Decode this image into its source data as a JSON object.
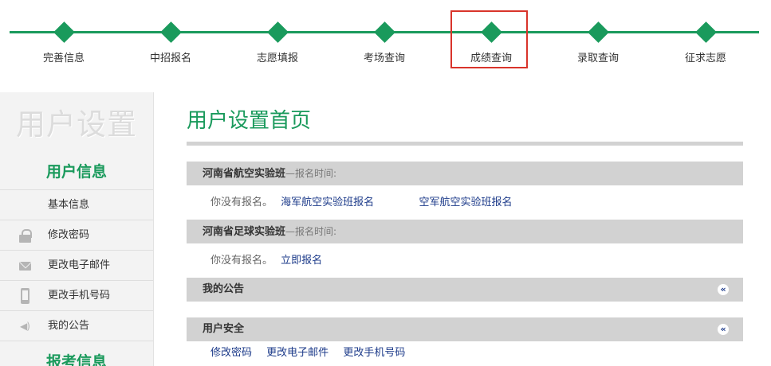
{
  "steps": [
    {
      "label": "完善信息"
    },
    {
      "label": "中招报名"
    },
    {
      "label": "志愿填报"
    },
    {
      "label": "考场查询"
    },
    {
      "label": "成绩查询"
    },
    {
      "label": "录取查询"
    },
    {
      "label": "征求志愿"
    }
  ],
  "sidebar": {
    "title": "用户设置",
    "section_user": "用户信息",
    "items": [
      {
        "label": "基本信息",
        "icon": "none"
      },
      {
        "label": "修改密码",
        "icon": "lock-icon"
      },
      {
        "label": "更改电子邮件",
        "icon": "mail-icon"
      },
      {
        "label": "更改手机号码",
        "icon": "phone-icon"
      },
      {
        "label": "我的公告",
        "icon": "speaker-icon"
      }
    ],
    "section_exam": "报考信息"
  },
  "main": {
    "title": "用户设置首页",
    "aviation": {
      "title": "河南省航空实验班",
      "sub": "—报名时间:",
      "status": "你没有报名。",
      "link1": "海军航空实验班报名",
      "link2": "空军航空实验班报名"
    },
    "football": {
      "title": "河南省足球实验班",
      "sub": "—报名时间:",
      "status": "你没有报名。",
      "link": "立即报名"
    },
    "notice": {
      "title": "我的公告",
      "toggle": "«"
    },
    "security": {
      "title": "用户安全",
      "toggle": "«",
      "links": [
        "修改密码",
        "更改电子邮件",
        "更改手机号码"
      ]
    }
  },
  "colors": {
    "accent": "#1a9a5c",
    "highlight": "#d9342b",
    "link": "#1d3b8a"
  }
}
